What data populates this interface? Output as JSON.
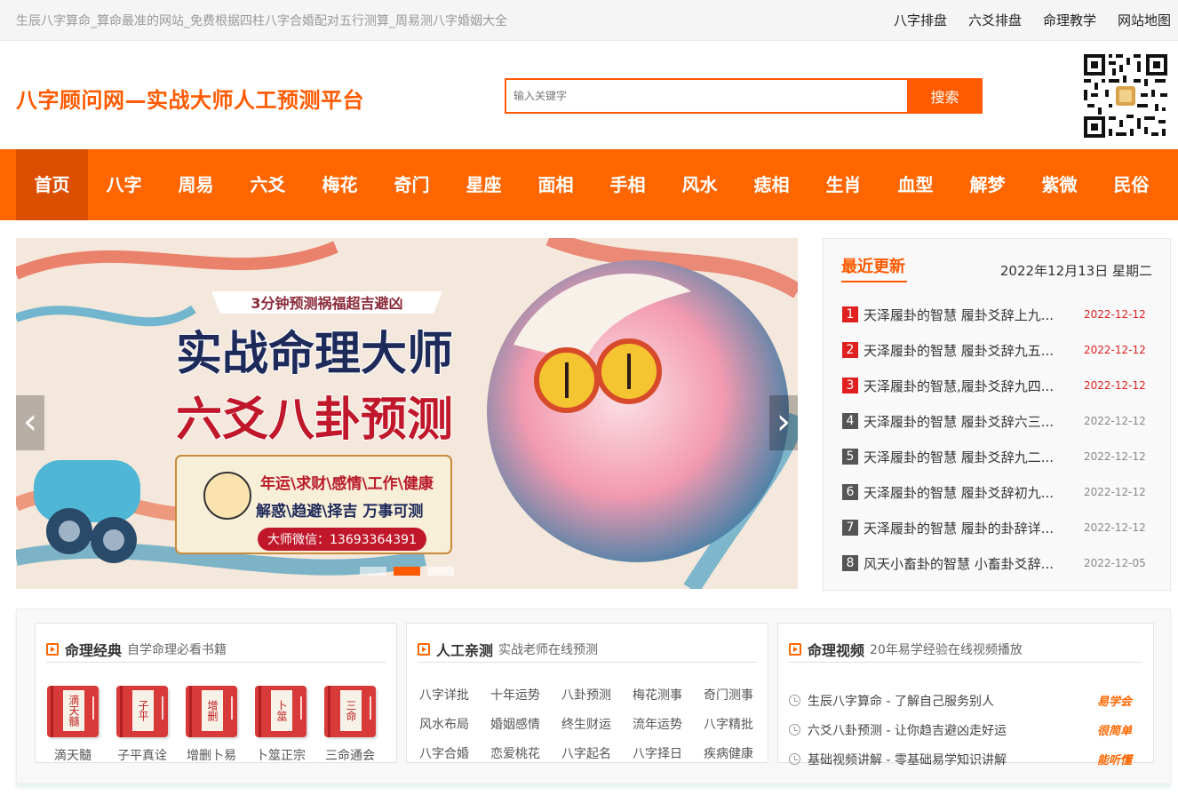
{
  "top_bar": {
    "site_description": "生辰八字算命_算命最准的网站_免费根据四柱八字合婚配对五行测算_周易测八字婚姻大全",
    "links": [
      "八字排盘",
      "六爻排盘",
      "命理教学",
      "网站地图"
    ]
  },
  "header": {
    "logo_text": "八字顾问网—实战大师人工预测平台",
    "search_placeholder": "输入关键字",
    "search_button": "搜索"
  },
  "nav": {
    "items": [
      "首页",
      "八字",
      "周易",
      "六爻",
      "梅花",
      "奇门",
      "星座",
      "面相",
      "手相",
      "风水",
      "痣相",
      "生肖",
      "血型",
      "解梦",
      "紫微",
      "民俗"
    ],
    "active_index": 0
  },
  "banner": {
    "headline_small": "3分钟预测祸福超吉避凶",
    "headline_1": "实战命理大师",
    "headline_2": "六爻八卦预测",
    "topics": "年运\\求财\\感情\\工作\\健康",
    "services": "解惑\\趋避\\择吉 万事可测",
    "wechat": "大师微信：13693364391",
    "prev_arrow": "‹",
    "next_arrow": "›",
    "slide_count": 3,
    "active_slide": 1
  },
  "recent": {
    "title": "最近更新",
    "date": "2022年12月13日 星期二",
    "items": [
      {
        "num": "1",
        "title": "天泽履卦的智慧 履卦爻辞上九...",
        "date": "2022-12-12",
        "hot": true
      },
      {
        "num": "2",
        "title": "天泽履卦的智慧 履卦爻辞九五...",
        "date": "2022-12-12",
        "hot": true
      },
      {
        "num": "3",
        "title": "天泽履卦的智慧,履卦爻辞九四...",
        "date": "2022-12-12",
        "hot": true
      },
      {
        "num": "4",
        "title": "天泽履卦的智慧 履卦爻辞六三...",
        "date": "2022-12-12",
        "hot": false
      },
      {
        "num": "5",
        "title": "天泽履卦的智慧 履卦爻辞九二...",
        "date": "2022-12-12",
        "hot": false
      },
      {
        "num": "6",
        "title": "天泽履卦的智慧 履卦爻辞初九...",
        "date": "2022-12-12",
        "hot": false
      },
      {
        "num": "7",
        "title": "天泽履卦的智慧 履卦的卦辞详...",
        "date": "2022-12-12",
        "hot": false
      },
      {
        "num": "8",
        "title": "风天小畜卦的智慧 小畜卦爻辞...",
        "date": "2022-12-05",
        "hot": false
      }
    ]
  },
  "classics": {
    "title": "命理经典",
    "subtitle": "自学命理必看书籍",
    "books": [
      {
        "cover": "滴天髓",
        "name": "滴天髓"
      },
      {
        "cover": "子平",
        "name": "子平真诠"
      },
      {
        "cover": "增删",
        "name": "增删卜易"
      },
      {
        "cover": "卜筮",
        "name": "卜筮正宗"
      },
      {
        "cover": "三命",
        "name": "三命通会"
      }
    ]
  },
  "consult": {
    "title": "人工亲测",
    "subtitle": "实战老师在线预测",
    "items": [
      "八字详批",
      "十年运势",
      "八卦预测",
      "梅花测事",
      "奇门测事",
      "风水布局",
      "婚姻感情",
      "终生财运",
      "流年运势",
      "八字精批",
      "八字合婚",
      "恋爱桃花",
      "八字起名",
      "八字择日",
      "疾病健康"
    ]
  },
  "videos": {
    "title": "命理视频",
    "subtitle": "20年易学经验在线视频播放",
    "items": [
      {
        "text": "生辰八字算命 - 了解自己服务别人",
        "tag": "易学会"
      },
      {
        "text": "六爻八卦预测 - 让你趋吉避凶走好运",
        "tag": "很简单"
      },
      {
        "text": "基础视频讲解 - 零基础易学知识讲解",
        "tag": "能听懂"
      }
    ]
  },
  "colors": {
    "brand": "#ff6600",
    "brand_dark": "#dc4f00",
    "hot_red": "#e02020"
  }
}
